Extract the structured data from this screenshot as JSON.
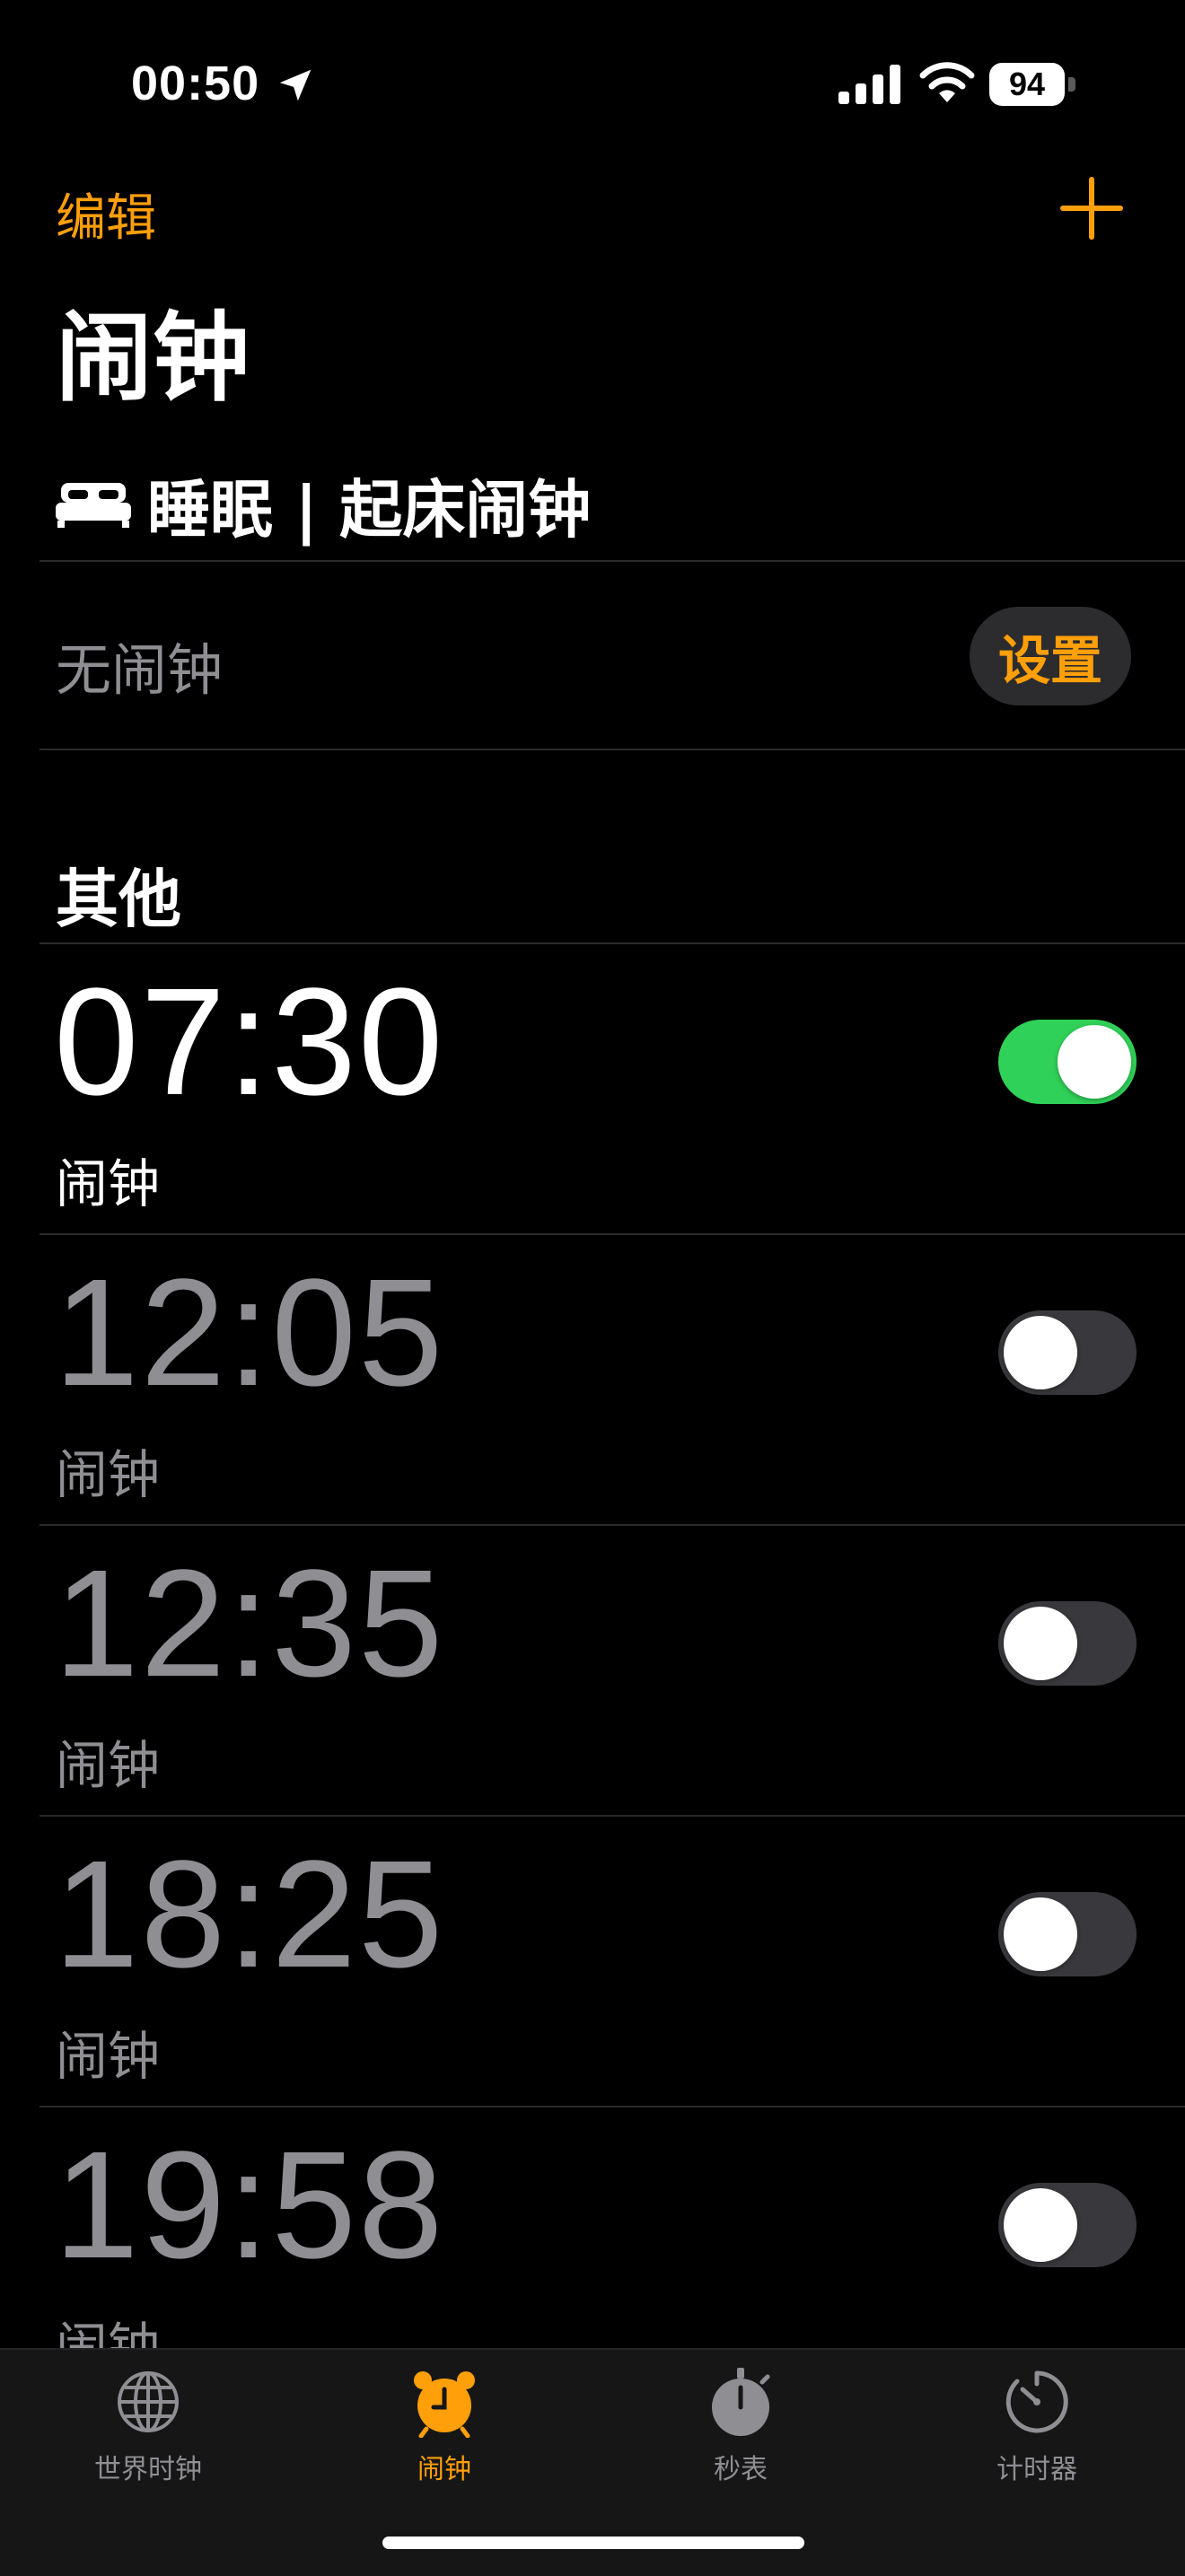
{
  "status_bar": {
    "time": "00:50",
    "battery_level": "94",
    "icons": [
      "location-arrow-icon",
      "signal-icon",
      "wifi-icon",
      "battery-icon"
    ]
  },
  "header": {
    "edit_label": "编辑",
    "add_icon": "plus-icon",
    "title": "闹钟"
  },
  "sleep": {
    "icon": "bed-icon",
    "title": "睡眠 | 起床闹钟",
    "status": "无闹钟",
    "setup_label": "设置"
  },
  "other": {
    "title": "其他",
    "alarms": [
      {
        "time": "07:30",
        "label": "闹钟",
        "enabled": true
      },
      {
        "time": "12:05",
        "label": "闹钟",
        "enabled": false
      },
      {
        "time": "12:35",
        "label": "闹钟",
        "enabled": false
      },
      {
        "time": "18:25",
        "label": "闹钟",
        "enabled": false
      },
      {
        "time": "19:58",
        "label": "闹钟",
        "enabled": false
      }
    ]
  },
  "tabs": [
    {
      "label": "世界时钟",
      "icon": "globe-icon",
      "active": false
    },
    {
      "label": "闹钟",
      "icon": "alarm-clock-icon",
      "active": true
    },
    {
      "label": "秒表",
      "icon": "stopwatch-icon",
      "active": false
    },
    {
      "label": "计时器",
      "icon": "timer-icon",
      "active": false
    }
  ],
  "colors": {
    "accent": "#FF9F0A",
    "toggle_on": "#30D158",
    "secondary_text": "#8e8e93",
    "background": "#000000"
  }
}
